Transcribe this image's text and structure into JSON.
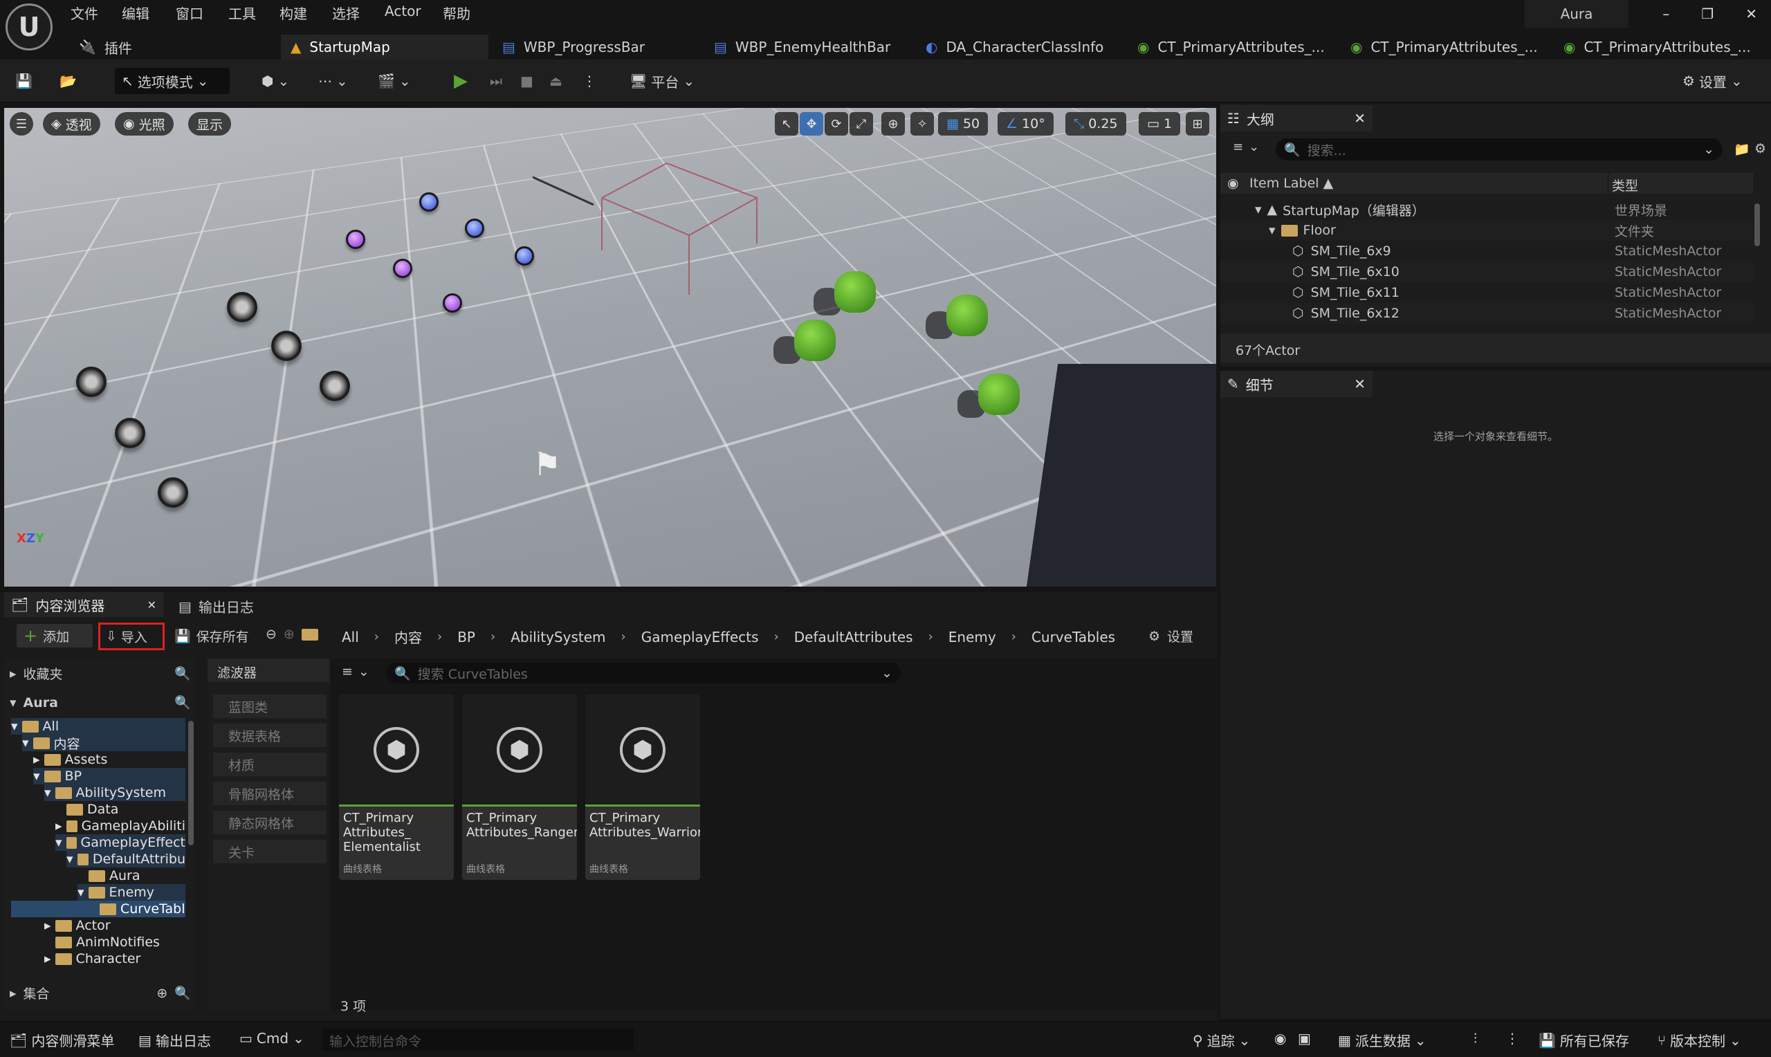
{
  "menu": {
    "logo": "U",
    "items": [
      "文件",
      "编辑",
      "窗口",
      "工具",
      "构建",
      "选择",
      "Actor",
      "帮助"
    ],
    "user": "Aura"
  },
  "tabs": {
    "plugins": "插件",
    "items": [
      "StartupMap",
      "WBP_ProgressBar",
      "WBP_EnemyHealthBar",
      "DA_CharacterClassInfo",
      "CT_PrimaryAttributes_...",
      "CT_PrimaryAttributes_...",
      "CT_PrimaryAttributes_..."
    ]
  },
  "toolbar": {
    "mode": "选项模式",
    "platform": "平台",
    "settings": "设置"
  },
  "viewport": {
    "perspective": "透视",
    "lighting": "光照",
    "show": "显示",
    "grid_snap": "50",
    "rot_snap": "10°",
    "scale_snap": "0.25",
    "cam_speed": "1"
  },
  "outliner": {
    "title": "大纲",
    "search_placeholder": "搜索...",
    "col_label": "Item Label ▲",
    "col_type": "类型",
    "rows": [
      {
        "label": "StartupMap（编辑器）",
        "type": "世界场景"
      },
      {
        "label": "Floor",
        "type": "文件夹"
      },
      {
        "label": "SM_Tile_6x9",
        "type": "StaticMeshActor"
      },
      {
        "label": "SM_Tile_6x10",
        "type": "StaticMeshActor"
      },
      {
        "label": "SM_Tile_6x11",
        "type": "StaticMeshActor"
      },
      {
        "label": "SM_Tile_6x12",
        "type": "StaticMeshActor"
      }
    ],
    "count": "67个Actor"
  },
  "details": {
    "title": "细节",
    "empty": "选择一个对象来查看细节。"
  },
  "content_browser": {
    "tab": "内容浏览器",
    "log_tab": "输出日志",
    "add": "添加",
    "import": "导入",
    "save_all": "保存所有",
    "settings": "设置",
    "breadcrumbs": [
      "All",
      "内容",
      "BP",
      "AbilitySystem",
      "GameplayEffects",
      "DefaultAttributes",
      "Enemy",
      "CurveTables"
    ],
    "favorites": "收藏夹",
    "project": "Aura",
    "collections": "集合",
    "filters_title": "滤波器",
    "filters": [
      "蓝图类",
      "数据表格",
      "材质",
      "骨骼网格体",
      "静态网格体",
      "关卡"
    ],
    "search_placeholder": "搜索 CurveTables",
    "tree": [
      "All",
      "内容",
      "Assets",
      "BP",
      "AbilitySystem",
      "Data",
      "GameplayAbiliti",
      "GameplayEffect",
      "DefaultAttribu",
      "Aura",
      "Enemy",
      "CurveTabl",
      "Actor",
      "AnimNotifies",
      "Character"
    ],
    "assets": [
      {
        "line1": "CT_Primary",
        "line2": "Attributes_",
        "line3": "Elementalist",
        "kind": "曲线表格"
      },
      {
        "line1": "CT_Primary",
        "line2": "Attributes_Ranger",
        "line3": "",
        "kind": "曲线表格"
      },
      {
        "line1": "CT_Primary",
        "line2": "Attributes_Warrior",
        "line3": "",
        "kind": "曲线表格"
      }
    ],
    "count": "3 项"
  },
  "statusbar": {
    "drawer": "内容侧滑菜单",
    "log": "输出日志",
    "cmd": "Cmd",
    "cmd_placeholder": "输入控制台命令",
    "trace": "追踪",
    "derived": "派生数据",
    "saved": "所有已保存",
    "vcs": "版本控制"
  },
  "colors": {
    "accent": "#5aa436",
    "highlight": "#e02020",
    "selected": "#2b4a6b"
  }
}
